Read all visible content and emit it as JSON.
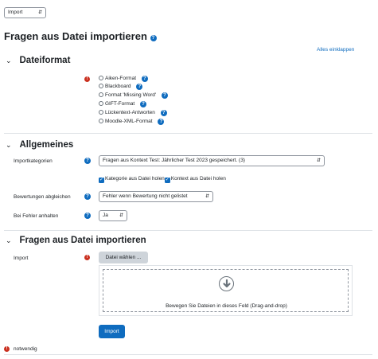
{
  "top_select": {
    "value": "Import"
  },
  "page_title": "Fragen aus Datei importieren",
  "collapse_all_link": "Alles einklappen",
  "sections": {
    "dateiformat": {
      "title": "Dateiformat",
      "options": [
        {
          "label": "Aiken-Format"
        },
        {
          "label": "Blackboard"
        },
        {
          "label": "Format 'Missing Word'"
        },
        {
          "label": "GIFT-Format"
        },
        {
          "label": "Lückentext-Antworten"
        },
        {
          "label": "Moodle-XML-Format"
        }
      ]
    },
    "allgemeines": {
      "title": "Allgemeines",
      "importkategorien_label": "Importkategorien",
      "importkategorien_value": "Fragen aus Kontext Test: Jährlicher Test 2023 gespeichert. (3)",
      "kategorie_checkbox": "Kategorie aus Datei holen",
      "kontext_checkbox": "Kontext aus Datei holen",
      "bewertungen_label": "Bewertungen abgleichen",
      "bewertungen_value": "Fehler wenn Bewertung nicht gelistet",
      "fehler_label": "Bei Fehler anhalten",
      "fehler_value": "Ja"
    },
    "import": {
      "title": "Fragen aus Datei importieren",
      "import_label": "Import",
      "choose_file_button": "Datei wählen ...",
      "dropzone_text": "Bewegen Sie Dateien in dieses Feld (Drag-and-drop)",
      "import_button": "Import"
    }
  },
  "required_note": "notwendig",
  "colors": {
    "primary": "#0f6cbf",
    "required": "#ca3120"
  }
}
